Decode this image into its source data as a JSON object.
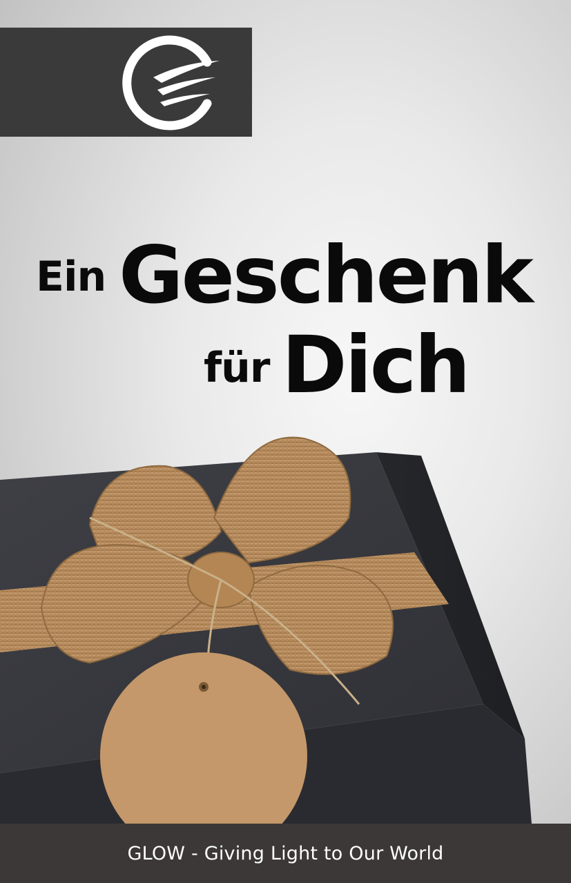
{
  "brand": {
    "logo_icon": "glow-g-logo-icon",
    "box_color": "#3a3a3a"
  },
  "title": {
    "line1_small": "Ein",
    "line1_large": "Geschenk",
    "line2_small": "für",
    "line2_large": "Dich"
  },
  "image": {
    "subject": "gift-box-icon"
  },
  "footer": {
    "text": "GLOW - Giving Light to Our World",
    "bg_color": "#3b3837"
  }
}
